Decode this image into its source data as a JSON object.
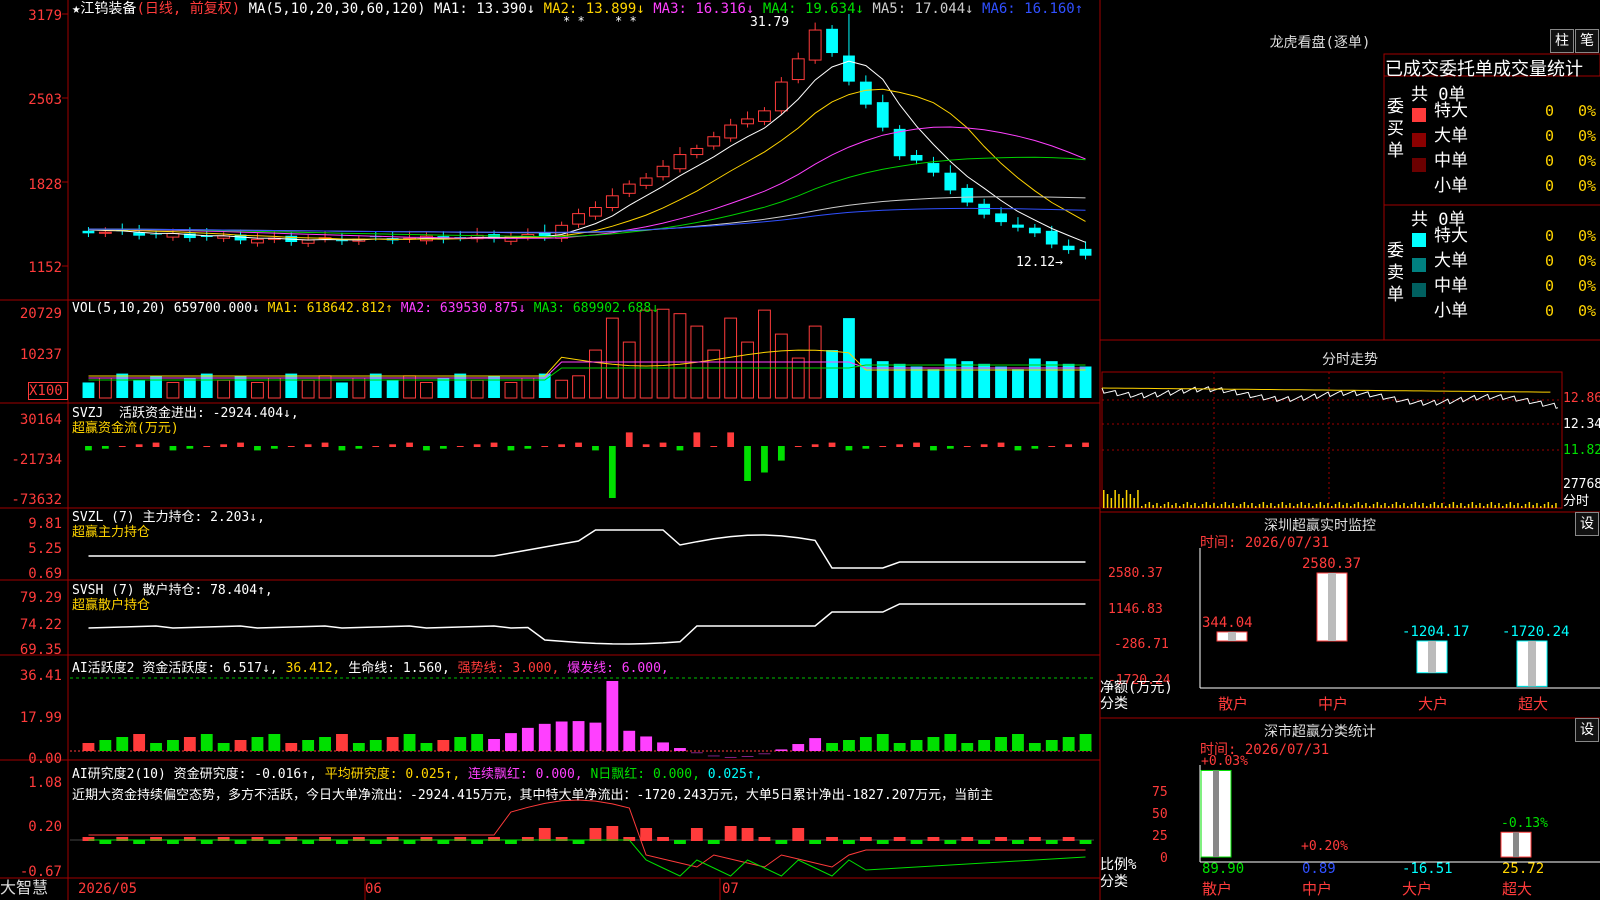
{
  "colors": {
    "up": "#ff3b3b",
    "down": "#00ffff",
    "grid": "#a00000",
    "ma1": "#ffffff",
    "ma2": "#ffd400",
    "ma3": "#ff40ff",
    "ma4": "#00d000",
    "ma5": "#cccccc",
    "ma6": "#3050ff"
  },
  "main": {
    "title": "★江钨装备",
    "mode": "(日线, 前复权)",
    "ma_params": "MA(5,10,20,30,60,120)",
    "ma1": "MA1: 13.390↓",
    "ma2": "MA2: 13.899↓",
    "ma3": "MA3: 16.316↓",
    "ma4": "MA4: 19.634↓",
    "ma5": "MA5: 17.044↓",
    "ma6": "MA6: 16.160↑",
    "y_ticks": [
      "3179",
      "2503",
      "1828",
      "1152"
    ],
    "high_label": "31.79",
    "low_label": "12.12→",
    "markers": [
      "* *",
      "* *"
    ]
  },
  "vol": {
    "params": "VOL(5,10,20)",
    "value": "659700.000↓",
    "ma1": "MA1: 618642.812↑",
    "ma2": "MA2: 639530.875↓",
    "ma3": "MA3: 689902.688↓",
    "y_ticks": [
      "20729",
      "10237"
    ],
    "unit": "X100"
  },
  "svzj": {
    "name": "SVZJ",
    "desc": "活跃资金进出: -2924.404↓,",
    "sub": "超赢资金流(万元)",
    "y_ticks": [
      "30164",
      "-21734",
      "-73632"
    ]
  },
  "svzl": {
    "name": "SVZL (7)",
    "desc": "主力持仓: 2.203↓,",
    "sub": "超赢主力持仓",
    "y_ticks": [
      "9.81",
      "5.25",
      "0.69"
    ]
  },
  "svsh": {
    "name": "SVSH (7)",
    "desc": "散户持仓: 78.404↑,",
    "sub": "超赢散户持仓",
    "y_ticks": [
      "79.29",
      "74.22",
      "69.35"
    ]
  },
  "ai1": {
    "name": "AI活跃度2",
    "v1": "资金活跃度: 6.517↓,",
    "v2": "36.412,",
    "v3": "生命线: 1.560,",
    "v4": "强势线: 3.000,",
    "v5": "爆发线: 6.000,",
    "y_ticks": [
      "36.41",
      "17.99",
      "0.00"
    ]
  },
  "ai2": {
    "name": "AI研究度2(10)",
    "v1": "资金研究度: -0.016↑,",
    "v2": "平均研究度: 0.025↑,",
    "v3": "连续飘红: 0.000,",
    "v4": "N日飘红: 0.000,",
    "v5": "0.025↑,",
    "commentary": "近期大资金持续偏空态势，多方不活跃，今日大单净流出：-2924.415万元，其中特大单净流出：-1720.243万元，大单5日累计净出-1827.207万元，当前主",
    "y_ticks": [
      "1.08",
      "0.20",
      "-0.67"
    ]
  },
  "xaxis": {
    "labels": [
      "2026/05",
      "06",
      "07"
    ]
  },
  "brand": "大智慧",
  "panel": {
    "title": "龙虎看盘(逐单)",
    "btn1": "柱",
    "btn2": "笔",
    "stat_title": "已成交委托单成交量统计",
    "buy": {
      "label": "委买单",
      "total": "共 0单",
      "rows": [
        {
          "name": "特大",
          "count": "0",
          "pct": "0%"
        },
        {
          "name": "大单",
          "count": "0",
          "pct": "0%"
        },
        {
          "name": "中单",
          "count": "0",
          "pct": "0%"
        },
        {
          "name": "小单",
          "count": "0",
          "pct": "0%"
        }
      ]
    },
    "sell": {
      "label": "委卖单",
      "total": "共 0单",
      "rows": [
        {
          "name": "特大",
          "count": "0",
          "pct": "0%"
        },
        {
          "name": "大单",
          "count": "0",
          "pct": "0%"
        },
        {
          "name": "中单",
          "count": "0",
          "pct": "0%"
        },
        {
          "name": "小单",
          "count": "0",
          "pct": "0%"
        }
      ]
    },
    "intraday_title": "分时走势",
    "intraday_ticks": [
      "12.86",
      "12.34",
      "11.82",
      "27768"
    ],
    "intraday_unit": "分时",
    "sz_title": "深圳超赢实时监控",
    "sz_btn": "设",
    "sz_time": "时间: 2026/07/31",
    "sz_ticks": [
      "2580.37",
      "1146.83",
      "-286.71",
      "-1720.24"
    ],
    "sz_ylabel": "净额(万元)",
    "sz_xlabel": "分类",
    "sz_bars": [
      {
        "cat": "散户",
        "label": "344.04",
        "value": 344.04
      },
      {
        "cat": "中户",
        "label": "2580.37",
        "value": 2580.37
      },
      {
        "cat": "大户",
        "label": "-1204.17",
        "value": -1204.17
      },
      {
        "cat": "超大",
        "label": "-1720.24",
        "value": -1720.24
      }
    ],
    "sc_title": "深市超赢分类统计",
    "sc_btn": "设",
    "sc_time": "时间: 2026/07/31",
    "sc_ticks": [
      "75",
      "50",
      "25",
      "0"
    ],
    "sc_ylabel": "比例%",
    "sc_xlabel": "分类",
    "sc_bars": [
      {
        "cat": "散户",
        "top": "+0.03%",
        "bottom": "89.90",
        "value": 89.9
      },
      {
        "cat": "中户",
        "top": "+0.20%",
        "bottom": "0.89",
        "value": 0.89
      },
      {
        "cat": "大户",
        "top": "",
        "bottom": "-16.51",
        "value": 0
      },
      {
        "cat": "超大",
        "top": "-0.13%",
        "bottom": "25.72",
        "value": 25.72
      }
    ]
  }
}
